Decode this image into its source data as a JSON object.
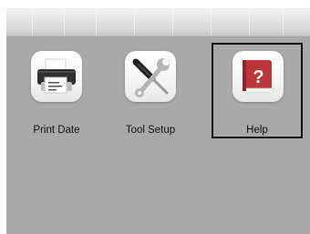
{
  "apps": [
    {
      "label": "Print Date",
      "icon": "printer-icon"
    },
    {
      "label": "Tool  Setup",
      "icon": "tools-icon"
    },
    {
      "label": "Help",
      "icon": "help-book-icon"
    }
  ],
  "selected_app": "Help",
  "colors": {
    "panel_background": "#a9a9a9",
    "focus_border": "#111111"
  }
}
